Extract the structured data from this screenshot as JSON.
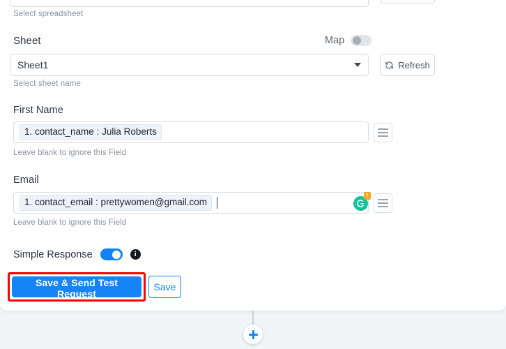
{
  "card": {
    "top_partial": {
      "input_value": "",
      "helper": "Select spreadsheet",
      "button_label": ""
    },
    "sheet_section": {
      "label": "Sheet",
      "map_label": "Map",
      "map_toggle_state": "off",
      "selected_sheet": "Sheet1",
      "refresh_label": "Refresh",
      "helper": "Select sheet name"
    },
    "first_name_section": {
      "label": "First Name",
      "chip_value": "1. contact_name : Julia Roberts",
      "helper": "Leave blank to ignore this Field"
    },
    "email_section": {
      "label": "Email",
      "chip_value": "1. contact_email : prettywomen@gmail.com",
      "helper": "Leave blank to ignore this Field",
      "grammarly_letter": "G",
      "grammarly_badge": "!"
    },
    "simple_response": {
      "label": "Simple Response",
      "toggle_state": "on",
      "info_glyph": "i"
    },
    "actions": {
      "primary_label": "Save & Send Test Request",
      "secondary_label": "Save",
      "highlight_color": "#fe0000",
      "primary_color": "#1684f7"
    }
  },
  "canvas": {
    "add_step_glyph": "+"
  }
}
